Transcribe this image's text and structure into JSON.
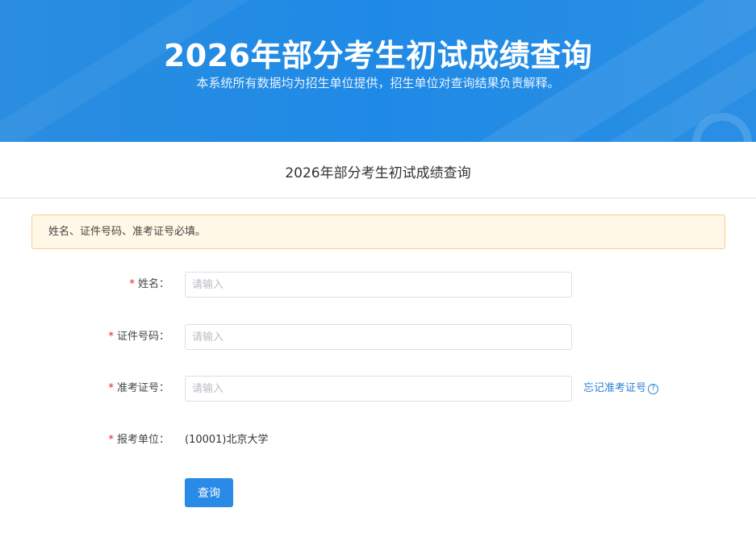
{
  "banner": {
    "title": "2026年部分考生初试成绩查询",
    "subtitle": "本系统所有数据均为招生单位提供，招生单位对查询结果负责解释。"
  },
  "page_title": "2026年部分考生初试成绩查询",
  "notice": "姓名、证件号码、准考证号必填。",
  "form": {
    "required_mark": "*",
    "name": {
      "label": "姓名：",
      "placeholder": "请输入"
    },
    "id_number": {
      "label": "证件号码：",
      "placeholder": "请输入"
    },
    "exam_number": {
      "label": "准考证号：",
      "placeholder": "请输入",
      "help_link": "忘记准考证号",
      "help_icon": "question-circle-icon"
    },
    "unit": {
      "label": "报考单位：",
      "value": "(10001)北京大学"
    },
    "submit_label": "查询"
  },
  "colors": {
    "banner_blue": "#1f8ae6",
    "primary_button": "#2a8be6",
    "link": "#2a7fd6",
    "required_star": "#e02020",
    "notice_bg": "#fff8e6",
    "notice_border": "#f6d08a"
  }
}
